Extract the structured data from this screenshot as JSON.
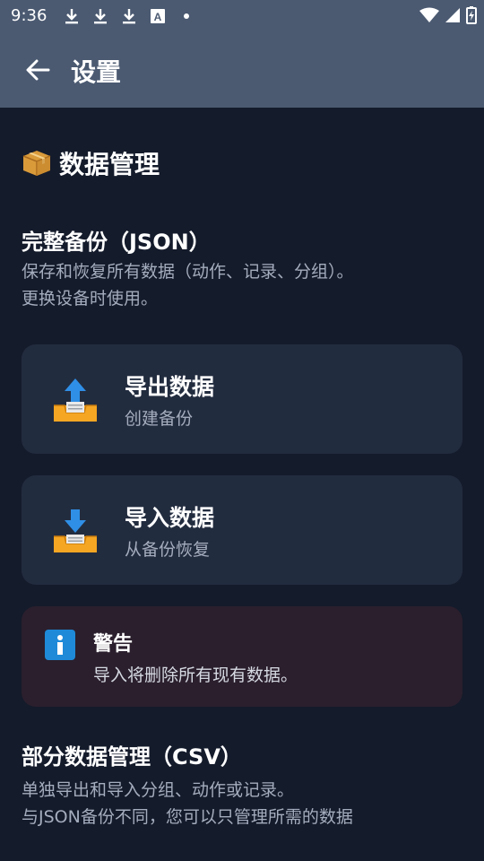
{
  "status_bar": {
    "time": "9:36",
    "icons": [
      "download-icon",
      "download-icon",
      "download-icon",
      "text-a-icon",
      "dot-icon",
      "wifi-icon",
      "signal-icon",
      "battery-icon"
    ]
  },
  "app_bar": {
    "title": "设置",
    "back_icon": "arrow-left-icon"
  },
  "data_management": {
    "title": "数据管理",
    "icon": "package-icon",
    "json_backup": {
      "title": "完整备份（JSON）",
      "description_line1": "保存和恢复所有数据（动作、记录、分组）。",
      "description_line2": "更换设备时使用。",
      "export_card": {
        "title": "导出数据",
        "subtitle": "创建备份",
        "icon": "tray-upload-icon"
      },
      "import_card": {
        "title": "导入数据",
        "subtitle": "从备份恢复",
        "icon": "tray-download-icon"
      }
    },
    "warning": {
      "title": "警告",
      "text": "导入将删除所有现有数据。",
      "icon": "info-icon",
      "colors": {
        "background": "#2b1f2d",
        "icon": "#1e8ad8"
      }
    },
    "csv": {
      "title": "部分数据管理（CSV）",
      "description_line1": "单独导出和导入分组、动作或记录。",
      "description_line2": "与JSON备份不同，您可以只管理所需的数据"
    }
  },
  "colors": {
    "background": "#141b2b",
    "app_bar": "#4b5a71",
    "card": "#222c3f",
    "accent_blue": "#2f8fe6",
    "tray_orange": "#f5a623"
  }
}
